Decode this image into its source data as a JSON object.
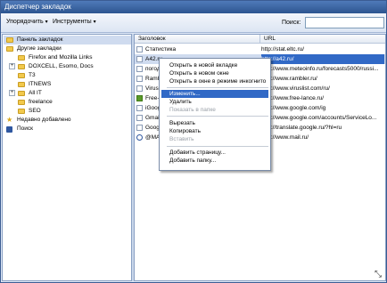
{
  "window": {
    "title": "Диспетчер закладок"
  },
  "toolbar": {
    "organize_label": "Упорядочить",
    "tools_label": "Инструменты",
    "search_label": "Поиск:",
    "search_value": ""
  },
  "tree": {
    "items": [
      {
        "label": "Панель закладок"
      },
      {
        "label": "Другие закладки"
      },
      {
        "label": "Firefox and Mozilla Links"
      },
      {
        "label": "DOXCELL, Esomo, Docs"
      },
      {
        "label": "Т3"
      },
      {
        "label": "ITNEWS"
      },
      {
        "label": "All IT"
      },
      {
        "label": "freelance"
      },
      {
        "label": "SEO"
      },
      {
        "label": "Недавно добавлено"
      },
      {
        "label": "Поиск"
      }
    ]
  },
  "table": {
    "columns": [
      "Заголовок",
      "URL"
    ],
    "rows": [
      {
        "title": "Статистика",
        "url": "http://stat.eltc.ru/"
      },
      {
        "title": "A42.ru",
        "url": "http://a42.ru/"
      },
      {
        "title": "погод",
        "url": "http://www.meteoinfo.ru/forecasts5000/russi..."
      },
      {
        "title": "Rambl",
        "url": "http://www.rambler.ru/"
      },
      {
        "title": "Virusli",
        "url": "http://www.viruslist.com/ru/"
      },
      {
        "title": "Free-l",
        "url": "http://www.free-lance.ru/"
      },
      {
        "title": "iGoog",
        "url": "http://www.google.com/ig"
      },
      {
        "title": "Gmail",
        "url": "http://www.google.com/accounts/ServiceLo..."
      },
      {
        "title": "Googl",
        "url": "http://translate.google.ru/?hl=ru"
      },
      {
        "title": "@MAI",
        "url": "http://www.mail.ru/"
      }
    ]
  },
  "context_menu": {
    "items": [
      {
        "label": "Открыть в новой вкладке"
      },
      {
        "label": "Открыть в новом окне"
      },
      {
        "label": "Открыть в окне в режиме инкогнито"
      },
      {
        "label": "Изменить..."
      },
      {
        "label": "Удалить"
      },
      {
        "label": "Показать в папке"
      },
      {
        "label": "Вырезать"
      },
      {
        "label": "Копировать"
      },
      {
        "label": "Вставить"
      },
      {
        "label": "Добавить страницу..."
      },
      {
        "label": "Добавить папку..."
      }
    ]
  },
  "icons": {
    "folder": "folder-icon",
    "star": "star-icon",
    "search": "search-icon",
    "resize": "resize-grip-icon"
  },
  "colors": {
    "selection": "#3169c6",
    "title_bar": "#2d5590",
    "folder": "#f2c94c"
  }
}
